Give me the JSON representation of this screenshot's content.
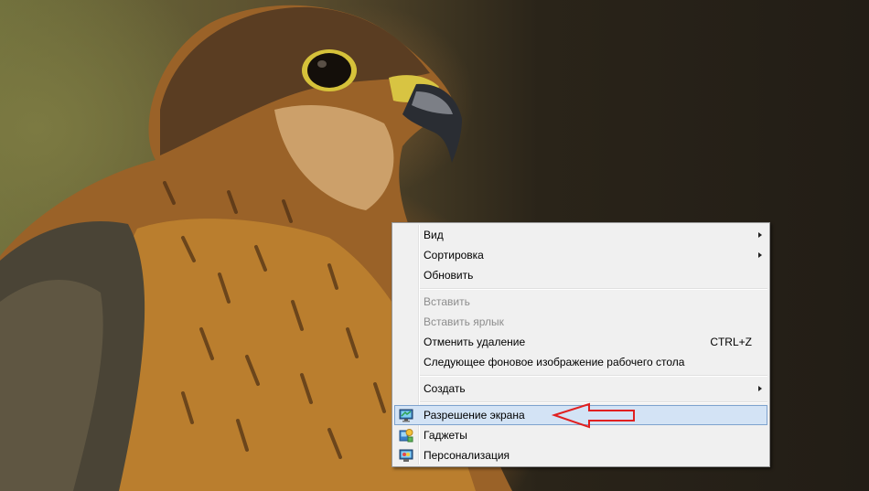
{
  "wallpaper": {
    "subject": "falcon"
  },
  "context_menu": {
    "items": [
      {
        "label": "Вид",
        "submenu": true,
        "enabled": true
      },
      {
        "label": "Сортировка",
        "submenu": true,
        "enabled": true
      },
      {
        "label": "Обновить",
        "enabled": true
      },
      {
        "label": "Вставить",
        "enabled": false
      },
      {
        "label": "Вставить ярлык",
        "enabled": false
      },
      {
        "label": "Отменить удаление",
        "shortcut": "CTRL+Z",
        "enabled": true
      },
      {
        "label": "Следующее фоновое изображение рабочего стола",
        "enabled": true
      },
      {
        "label": "Создать",
        "submenu": true,
        "enabled": true
      },
      {
        "label": "Разрешение экрана",
        "enabled": true,
        "highlighted": true,
        "icon": "screen-resolution-icon"
      },
      {
        "label": "Гаджеты",
        "enabled": true,
        "icon": "gadgets-icon"
      },
      {
        "label": "Персонализация",
        "enabled": true,
        "icon": "personalization-icon"
      }
    ]
  },
  "colors": {
    "menu_background": "#f0f0f0",
    "highlight": "#d3e3f5",
    "disabled_text": "#8d8d8d",
    "annotation_arrow": "#e02020"
  }
}
